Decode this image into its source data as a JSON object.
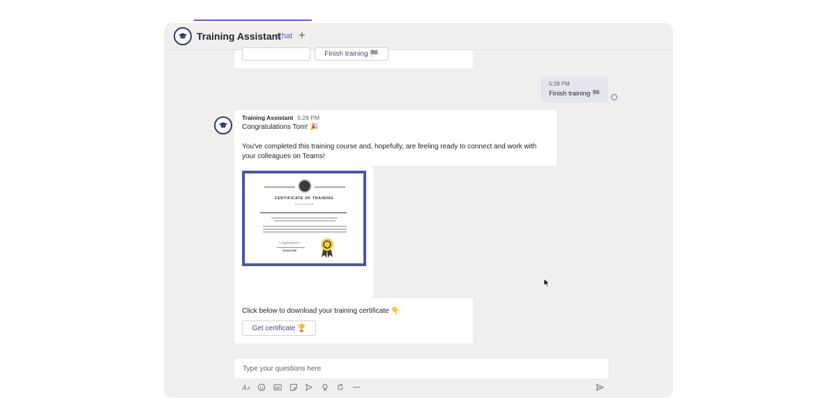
{
  "header": {
    "app_title": "Training Assistant",
    "tab_chat": "Chat",
    "add_tab": "+"
  },
  "previous_card": {
    "finish_button": "Finish training 🏁"
  },
  "self_message": {
    "time": "5:28 PM",
    "text": "Finish training 🏁"
  },
  "bot_message": {
    "sender": "Training Assistant",
    "time": "5:28 PM",
    "greeting": "Congratulations Tom! 🎉",
    "body_line1": "You've completed this training course and, hopefully, are feeling ready to connect and work with",
    "body_line2": "your colleagues on Teams!"
  },
  "certificate": {
    "title": "CERTIFICATE OF TRAINING",
    "subtitle": "This is to certify that",
    "signature_label": "SIGNATURE"
  },
  "download_card": {
    "text": "Click below to download your training certificate 👇",
    "button": "Get certificate 🏆"
  },
  "compose": {
    "placeholder": "Type your questions here"
  },
  "toolbar_icons": [
    "format-icon",
    "emoji-icon",
    "gif-icon",
    "sticker-icon",
    "meet-icon",
    "praise-icon",
    "loop-icon",
    "more-icon"
  ],
  "colors": {
    "accent": "#5b5fc7",
    "background": "#f0efee",
    "self_bubble": "#e5e5f1",
    "certificate_border": "#4b54a8"
  }
}
